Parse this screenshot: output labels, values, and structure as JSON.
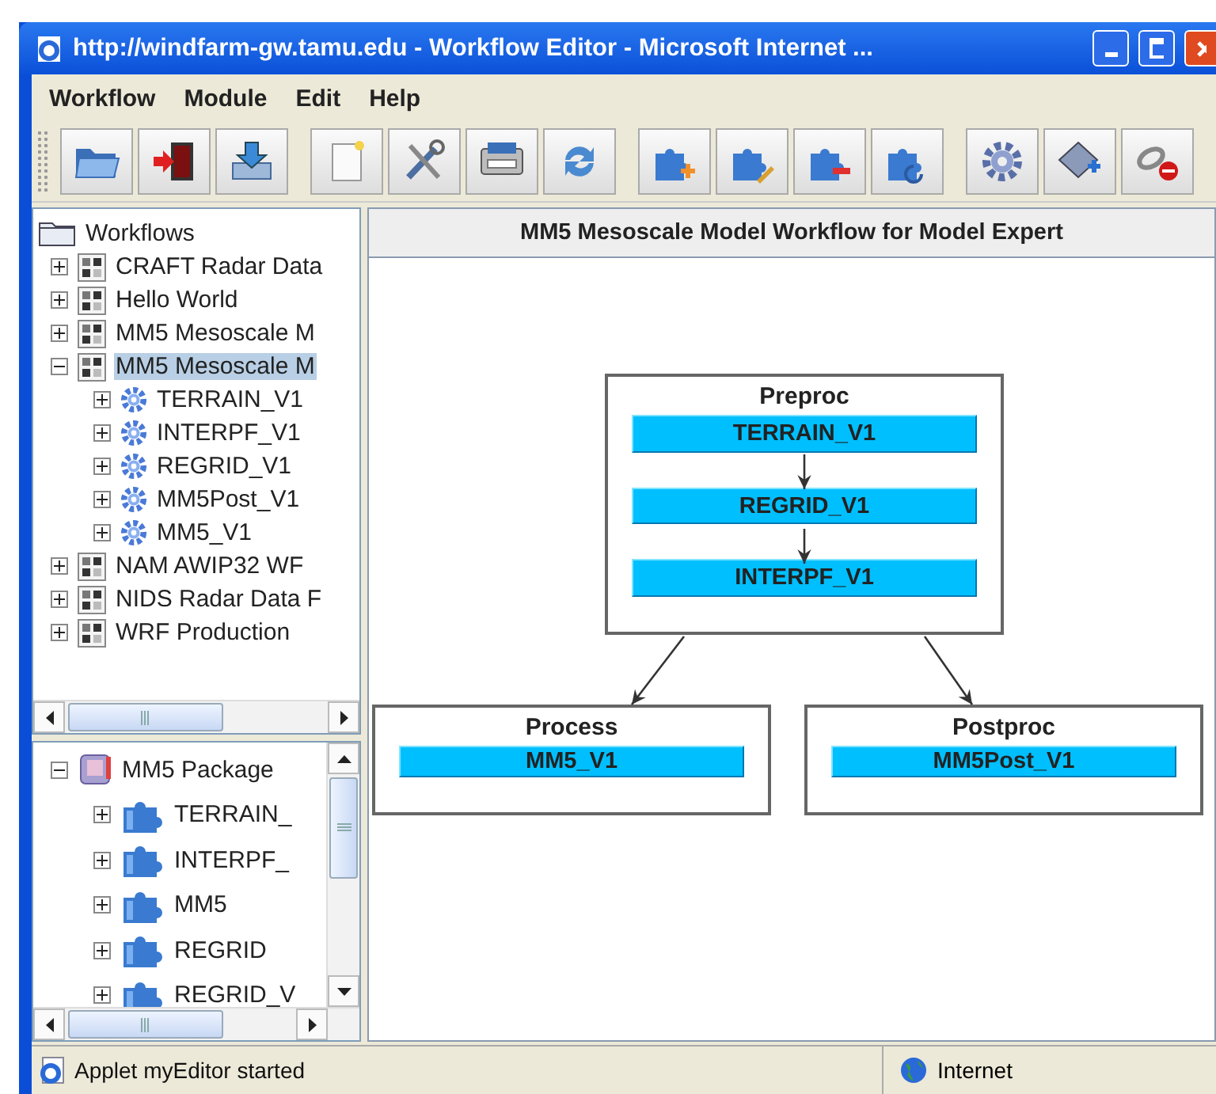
{
  "window": {
    "title": "http://windfarm-gw.tamu.edu - Workflow Editor - Microsoft Internet ..."
  },
  "menu": [
    "Workflow",
    "Module",
    "Edit",
    "Help"
  ],
  "workflow_tree": {
    "root": "Workflows",
    "items": [
      {
        "label": "CRAFT Radar Data",
        "kind": "workflow",
        "expanded": false,
        "selected": false
      },
      {
        "label": "Hello World",
        "kind": "workflow",
        "expanded": false,
        "selected": false
      },
      {
        "label": "MM5 Mesoscale M",
        "kind": "workflow",
        "expanded": false,
        "selected": false
      },
      {
        "label": "MM5 Mesoscale M",
        "kind": "workflow",
        "expanded": true,
        "selected": true,
        "children": [
          {
            "label": "TERRAIN_V1",
            "kind": "module",
            "expanded": false,
            "selected": false
          },
          {
            "label": "INTERPF_V1",
            "kind": "module",
            "expanded": false,
            "selected": false
          },
          {
            "label": "REGRID_V1",
            "kind": "module",
            "expanded": false,
            "selected": false
          },
          {
            "label": "MM5Post_V1",
            "kind": "module",
            "expanded": false,
            "selected": false
          },
          {
            "label": "MM5_V1",
            "kind": "module",
            "expanded": false,
            "selected": false
          }
        ]
      },
      {
        "label": "NAM AWIP32 WF",
        "kind": "workflow",
        "expanded": false,
        "selected": false
      },
      {
        "label": "NIDS Radar Data F",
        "kind": "workflow",
        "expanded": false,
        "selected": false
      },
      {
        "label": "WRF Production",
        "kind": "workflow",
        "expanded": false,
        "selected": false
      }
    ]
  },
  "package_tree": {
    "items": [
      {
        "label": "MM5 Package",
        "kind": "package",
        "expanded": true,
        "selected": false,
        "children": [
          {
            "label": "TERRAIN_",
            "kind": "component",
            "expanded": false,
            "selected": false
          },
          {
            "label": "INTERPF_",
            "kind": "component",
            "expanded": false,
            "selected": false
          },
          {
            "label": "MM5",
            "kind": "component",
            "expanded": false,
            "selected": false
          },
          {
            "label": "REGRID",
            "kind": "component",
            "expanded": false,
            "selected": false
          },
          {
            "label": "REGRID_V",
            "kind": "component",
            "expanded": false,
            "selected": false
          }
        ]
      }
    ]
  },
  "diagram": {
    "title": "MM5 Mesoscale Model Workflow for Model Expert",
    "groups": [
      {
        "name": "Preproc",
        "tasks": [
          "TERRAIN_V1",
          "REGRID_V1",
          "INTERPF_V1"
        ]
      },
      {
        "name": "Process",
        "tasks": [
          "MM5_V1"
        ]
      },
      {
        "name": "Postproc",
        "tasks": [
          "MM5Post_V1"
        ]
      }
    ]
  },
  "status_bar": {
    "message": "Applet myEditor started",
    "zone": "Internet"
  }
}
